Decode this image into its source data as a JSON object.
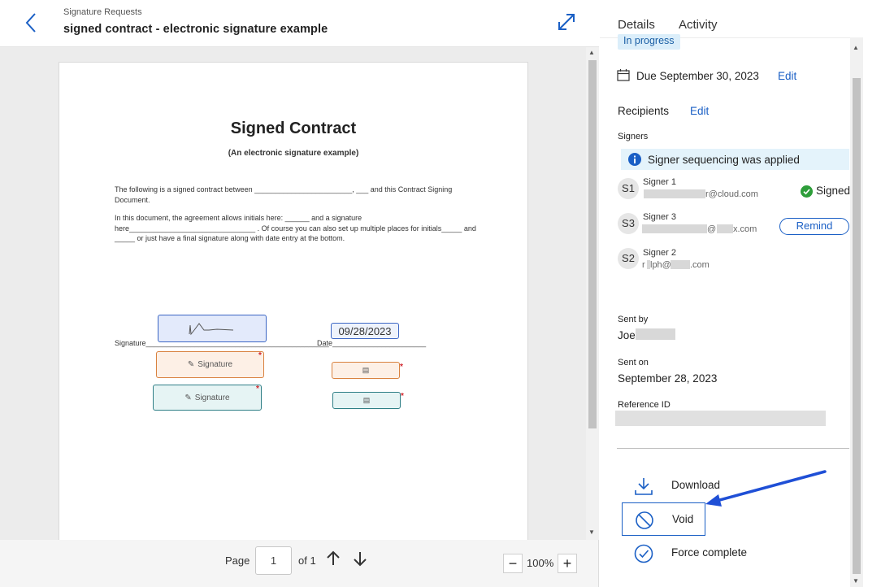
{
  "header": {
    "breadcrumb": "Signature Requests",
    "title": "signed contract - electronic signature example"
  },
  "document": {
    "heading": "Signed Contract",
    "subheading": "(An electronic signature example)",
    "para1": "The following is a signed contract between ________________________, ___ and this Contract Signing Document.",
    "para2": "In this document, the agreement allows initials here: ______ and a signature here_______________________________ . Of course you can also set up multiple places for initials_____ and _____ or just have a final signature along with date entry at the bottom.",
    "signature_line": "Signature_____________________________________________",
    "date_line": "Date_______________________",
    "date_value": "09/28/2023",
    "signature_field_1": "Signature",
    "signature_field_2": "Signature",
    "required_mark": "*"
  },
  "pager": {
    "page_label": "Page",
    "page_value": "1",
    "of_label": "of 1",
    "zoom": "100%",
    "zoom_out": "−",
    "zoom_in": "+"
  },
  "panel": {
    "tabs": [
      "Details",
      "Activity"
    ],
    "status": "In progress",
    "due": "Due September 30, 2023",
    "edit_due": "Edit",
    "recipients_label": "Recipients",
    "edit_recipients": "Edit",
    "signers_label": "Signers",
    "banner": "Signer sequencing was applied",
    "signers": [
      {
        "initials": "S1",
        "name": "Signer 1",
        "email_tail": "r@cloud.com",
        "status": "Signed"
      },
      {
        "initials": "S3",
        "name": "Signer 3",
        "email_mid": "@",
        "email_tail": "x.com",
        "action": "Remind"
      },
      {
        "initials": "S2",
        "name": "Signer 2",
        "email_head": "r",
        "email_mid": "lph@",
        "email_tail": ".com"
      }
    ],
    "sent_by_label": "Sent by",
    "sent_by_value": "Joe",
    "sent_on_label": "Sent on",
    "sent_on_value": "September 28, 2023",
    "reference_label": "Reference ID",
    "actions": [
      "Download",
      "Void",
      "Force complete"
    ]
  },
  "colors": {
    "accent": "#1a5fc5",
    "signed_green": "#2e9e3a",
    "required_red": "#d0262c",
    "annotation_arrow": "#1f4fd6"
  }
}
